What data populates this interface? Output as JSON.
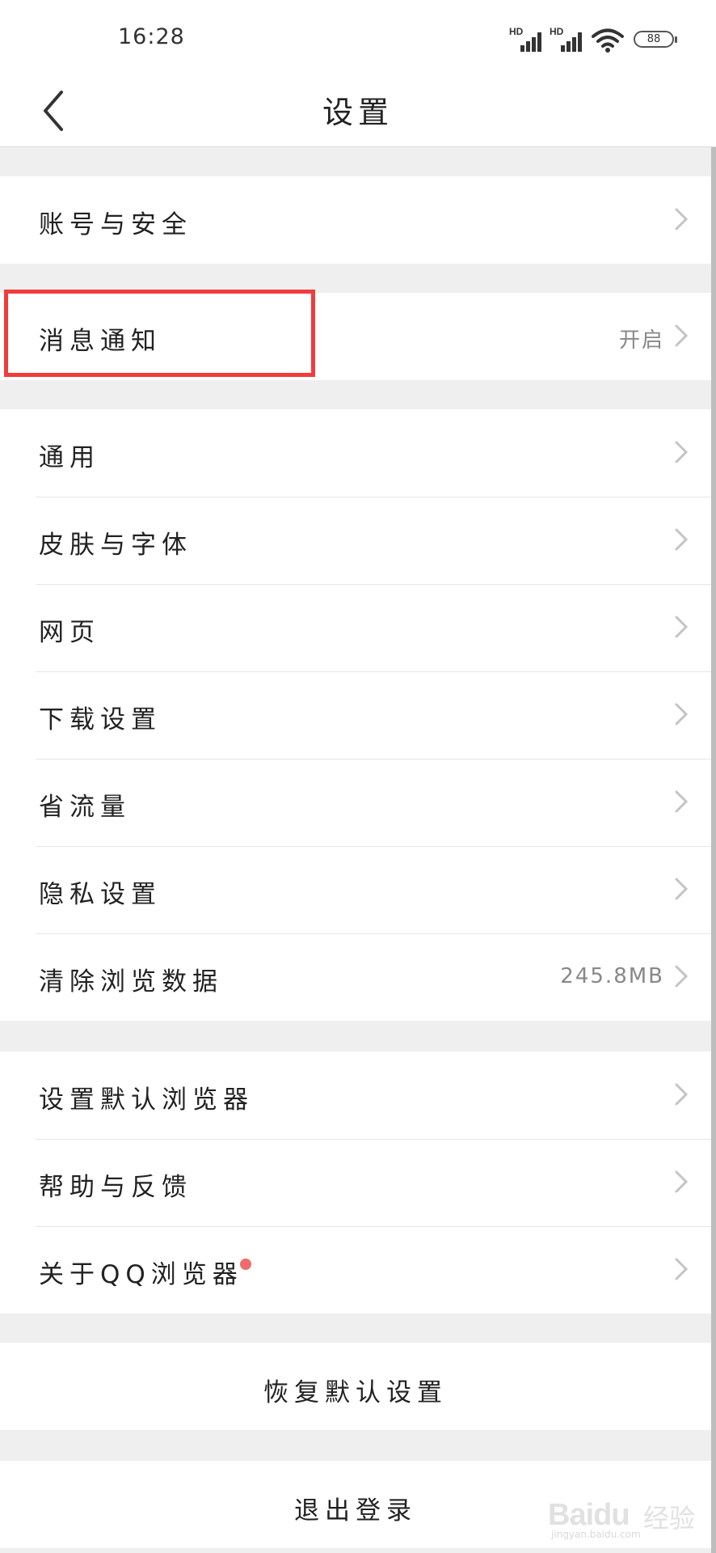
{
  "status_bar": {
    "time": "16:28",
    "signal_1_label": "HD",
    "signal_2_label": "HD",
    "battery": "88"
  },
  "header": {
    "title": "设置",
    "back_icon": "chevron-left-icon"
  },
  "groups": [
    {
      "items": [
        {
          "label": "账号与安全",
          "value": ""
        }
      ]
    },
    {
      "items": [
        {
          "label": "消息通知",
          "value": "开启"
        }
      ]
    },
    {
      "items": [
        {
          "label": "通用",
          "value": ""
        },
        {
          "label": "皮肤与字体",
          "value": ""
        },
        {
          "label": "网页",
          "value": ""
        },
        {
          "label": "下载设置",
          "value": ""
        },
        {
          "label": "省流量",
          "value": ""
        },
        {
          "label": "隐私设置",
          "value": ""
        },
        {
          "label": "清除浏览数据",
          "value": "245.8MB"
        }
      ]
    },
    {
      "items": [
        {
          "label": "设置默认浏览器",
          "value": ""
        },
        {
          "label": "帮助与反馈",
          "value": ""
        },
        {
          "label": "关于QQ浏览器",
          "value": "",
          "badge": "red-dot"
        }
      ]
    }
  ],
  "actions": {
    "restore_defaults": "恢复默认设置",
    "logout": "退出登录"
  },
  "watermark": {
    "brand": "Baidu",
    "brand_cn": "经验",
    "url": "jingyan.baidu.com"
  },
  "colors": {
    "highlight": "#f23b3b",
    "badge": "#f06b6b",
    "background": "#efefef"
  }
}
